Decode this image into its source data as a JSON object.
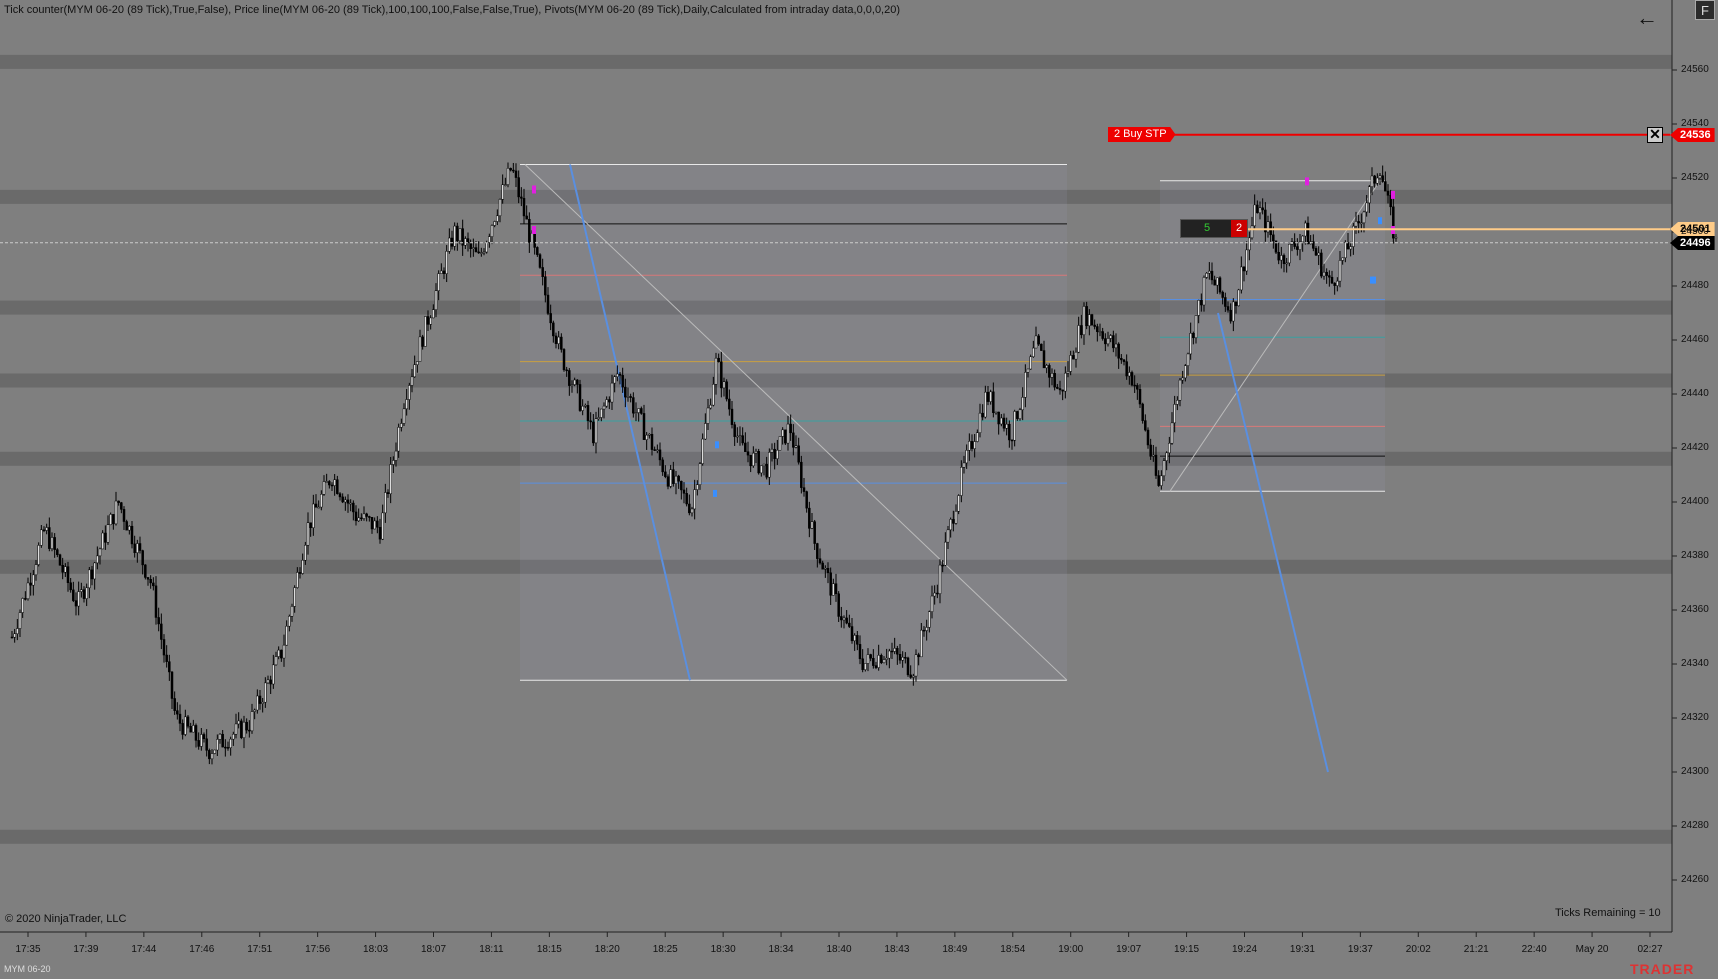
{
  "header": {
    "indicators_text": "Tick counter(MYM 06-20 (89 Tick),True,False), Price line(MYM 06-20 (89 Tick),100,100,100,False,False,True), Pivots(MYM 06-20 (89 Tick),Daily,Calculated from intraday data,0,0,0,20)"
  },
  "toolbar": {
    "back_icon": "←",
    "f_label": "F"
  },
  "footer": {
    "copyright": "© 2020 NinjaTrader, LLC",
    "ticks_remaining": "Ticks Remaining = 10",
    "instrument": "MYM 06-20",
    "brand": "TRADER"
  },
  "order": {
    "label": "2  Buy STP",
    "price": "24536",
    "close_icon": "✕"
  },
  "position": {
    "qty": "5",
    "count": "2"
  },
  "price_tags": {
    "ask": "24501",
    "last": "24496"
  },
  "colors": {
    "background": "#7f7f7f",
    "order_red": "#e00000",
    "ask_line": "#ffcc88",
    "fib_blue": "#5a8fe0",
    "marker_magenta": "#e020e0"
  },
  "y_axis": {
    "labels": [
      "24560",
      "24540",
      "24520",
      "24500",
      "24480",
      "24460",
      "24440",
      "24420",
      "24400",
      "24380",
      "24360",
      "24340",
      "24320",
      "24300",
      "24280",
      "24260"
    ]
  },
  "x_axis": {
    "labels": [
      "17:35",
      "17:39",
      "17:44",
      "17:46",
      "17:51",
      "17:56",
      "18:03",
      "18:07",
      "18:11",
      "18:15",
      "18:20",
      "18:25",
      "18:30",
      "18:34",
      "18:40",
      "18:43",
      "18:49",
      "18:54",
      "19:00",
      "19:07",
      "19:15",
      "19:24",
      "19:31",
      "19:37",
      "20:02",
      "21:21",
      "22:40",
      "May 20",
      "02:27"
    ]
  },
  "chart_data": {
    "type": "candlestick",
    "instrument": "MYM 06-20 (89 Tick)",
    "ylim": [
      24250,
      24575
    ],
    "y_ticks": [
      24560,
      24540,
      24520,
      24500,
      24480,
      24460,
      24440,
      24420,
      24400,
      24380,
      24360,
      24340,
      24320,
      24300,
      24280,
      24260
    ],
    "close_path": [
      {
        "t": 0,
        "p": 24350
      },
      {
        "t": 0.02,
        "p": 24390
      },
      {
        "t": 0.04,
        "p": 24362
      },
      {
        "t": 0.065,
        "p": 24400
      },
      {
        "t": 0.085,
        "p": 24370
      },
      {
        "t": 0.1,
        "p": 24320
      },
      {
        "t": 0.12,
        "p": 24308
      },
      {
        "t": 0.145,
        "p": 24318
      },
      {
        "t": 0.165,
        "p": 24345
      },
      {
        "t": 0.18,
        "p": 24390
      },
      {
        "t": 0.195,
        "p": 24410
      },
      {
        "t": 0.21,
        "p": 24395
      },
      {
        "t": 0.225,
        "p": 24390
      },
      {
        "t": 0.24,
        "p": 24440
      },
      {
        "t": 0.255,
        "p": 24470
      },
      {
        "t": 0.27,
        "p": 24500
      },
      {
        "t": 0.285,
        "p": 24490
      },
      {
        "t": 0.305,
        "p": 24524
      },
      {
        "t": 0.32,
        "p": 24490
      },
      {
        "t": 0.335,
        "p": 24455
      },
      {
        "t": 0.355,
        "p": 24425
      },
      {
        "t": 0.37,
        "p": 24448
      },
      {
        "t": 0.385,
        "p": 24428
      },
      {
        "t": 0.4,
        "p": 24410
      },
      {
        "t": 0.415,
        "p": 24398
      },
      {
        "t": 0.43,
        "p": 24452
      },
      {
        "t": 0.445,
        "p": 24420
      },
      {
        "t": 0.46,
        "p": 24412
      },
      {
        "t": 0.475,
        "p": 24428
      },
      {
        "t": 0.49,
        "p": 24385
      },
      {
        "t": 0.505,
        "p": 24360
      },
      {
        "t": 0.52,
        "p": 24340
      },
      {
        "t": 0.535,
        "p": 24345
      },
      {
        "t": 0.55,
        "p": 24338
      },
      {
        "t": 0.565,
        "p": 24370
      },
      {
        "t": 0.58,
        "p": 24410
      },
      {
        "t": 0.595,
        "p": 24440
      },
      {
        "t": 0.61,
        "p": 24425
      },
      {
        "t": 0.625,
        "p": 24458
      },
      {
        "t": 0.64,
        "p": 24440
      },
      {
        "t": 0.655,
        "p": 24470
      },
      {
        "t": 0.67,
        "p": 24460
      },
      {
        "t": 0.685,
        "p": 24445
      },
      {
        "t": 0.7,
        "p": 24405
      },
      {
        "t": 0.715,
        "p": 24450
      },
      {
        "t": 0.73,
        "p": 24485
      },
      {
        "t": 0.745,
        "p": 24470
      },
      {
        "t": 0.76,
        "p": 24510
      },
      {
        "t": 0.775,
        "p": 24490
      },
      {
        "t": 0.79,
        "p": 24500
      },
      {
        "t": 0.805,
        "p": 24480
      },
      {
        "t": 0.82,
        "p": 24500
      },
      {
        "t": 0.835,
        "p": 24525
      },
      {
        "t": 0.845,
        "p": 24496
      }
    ],
    "pivot_bands": [
      24563,
      24513,
      24472,
      24445,
      24416,
      24376,
      24276
    ],
    "last_price": 24496,
    "ask_price": 24501,
    "buy_stop": 24536,
    "fib_left": {
      "top": 24525,
      "bottom": 24334,
      "levels": [
        {
          "price": 24525,
          "color": "#e8e8e8"
        },
        {
          "price": 24503,
          "color": "#111111"
        },
        {
          "price": 24484,
          "color": "#d87878"
        },
        {
          "price": 24452,
          "color": "#c8a040"
        },
        {
          "price": 24430,
          "color": "#3aa0a0"
        },
        {
          "price": 24407,
          "color": "#5a8fe0"
        },
        {
          "price": 24334,
          "color": "#e8e8e8"
        }
      ]
    },
    "fib_right": {
      "top": 24519,
      "bottom": 24404,
      "levels": [
        {
          "price": 24519,
          "color": "#e8e8e8"
        },
        {
          "price": 24475,
          "color": "#5a8fe0"
        },
        {
          "price": 24461,
          "color": "#3aa0a0"
        },
        {
          "price": 24447,
          "color": "#c8a040"
        },
        {
          "price": 24428,
          "color": "#d87878"
        },
        {
          "price": 24417,
          "color": "#111111"
        },
        {
          "price": 24404,
          "color": "#e8e8e8"
        }
      ]
    }
  }
}
